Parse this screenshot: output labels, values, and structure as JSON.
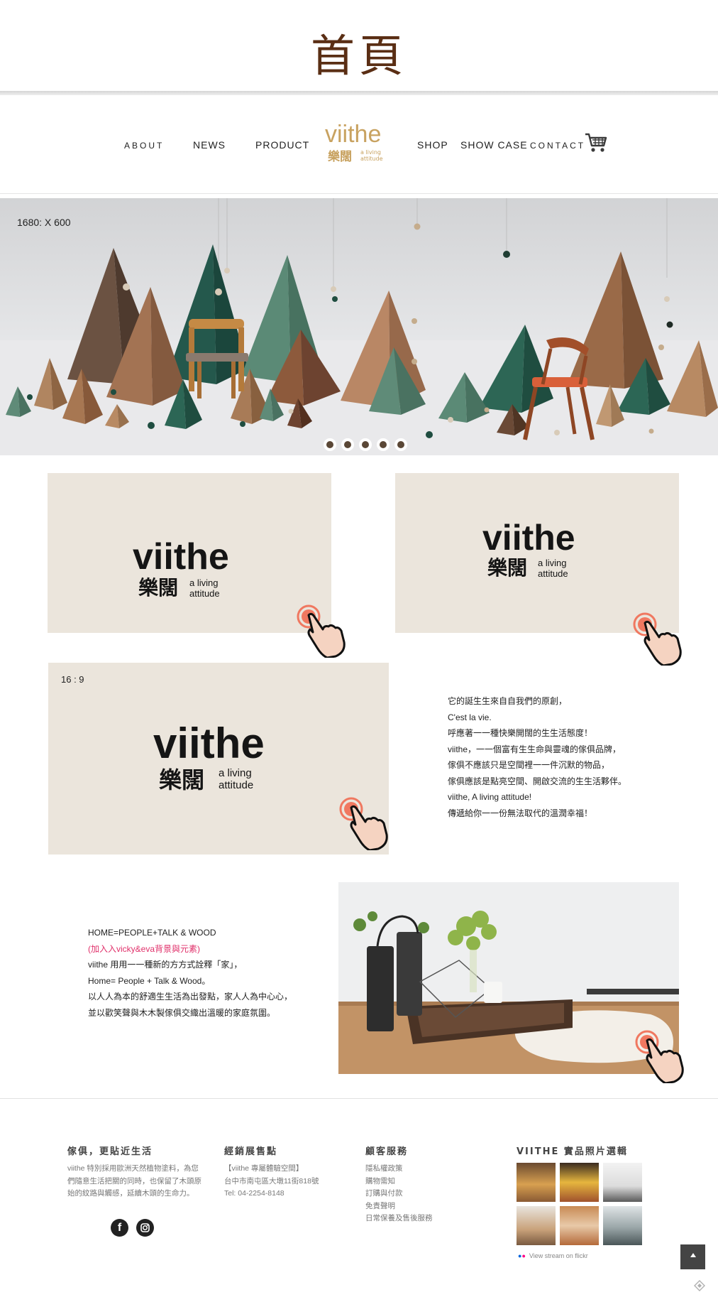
{
  "page_heading": "首頁",
  "nav": {
    "about": "ABOUT",
    "news": "NEWS",
    "product": "PRODUCT",
    "shop": "SHOP",
    "showcase": "SHOW CASE",
    "contact": "CONTACT",
    "logo_word": "viithe",
    "logo_cjk": "樂闊",
    "logo_sub": "a living attitude",
    "cart_icon": "shopping-cart-icon"
  },
  "hero": {
    "dimension_label": "1680: X 600",
    "slide_count": 5
  },
  "cards": {
    "brand_word": "viithe",
    "brand_cjk": "樂闊",
    "brand_sub_line1": "a living",
    "brand_sub_line2": "attitude",
    "wide_dimension_label": "16 : 9",
    "hand_icon": "tap-hand-icon"
  },
  "intro_text": [
    "它的誕生生來自自我們的原創，",
    "C'est la vie.",
    "呼應著一一種快樂開闊的生生活態度！",
    "viithe，一一個富有生生命與靈魂的傢俱品牌，",
    "傢俱不應該只是空間裡一一件沉默的物品，",
    "傢俱應該是點亮空間、開啟交流的生生活夥伴。",
    "viithe, A living attitude!",
    "傳遞給你一一份無法取代的溫潤幸福！"
  ],
  "home_text": {
    "line1": "HOME=PEOPLE+TALK & WOOD",
    "line2_pink": "(加入入vicky&eva背景與元素)",
    "line3": "viithe 用用一一種新的方方式詮釋「家」，",
    "line4": "Home= People + Talk & Wood。",
    "line5": "以人人為本的舒適生生活為出發點，家人人為中心心，",
    "line6": "並以歡笑聲與木木製傢俱交織出溫暖的家庭氛圍。"
  },
  "footer": {
    "col1_title": "傢俱，更貼近生活",
    "col1_lines": [
      "viithe 特別採用歐洲天然植物塗料，為您",
      "們隨意生活把關的同時，也保留了木頭原",
      "始的紋路與觸感，延續木頭的生命力。"
    ],
    "col2_title": "經銷展售點",
    "col2_lines": [
      "【viithe 專屬體驗空間】",
      "台中市南屯區大墩11街818號",
      "Tel: 04-2254-8148"
    ],
    "col3_title": "顧客服務",
    "col3_links": [
      "隱私權政策",
      "購物需知",
      "訂購與付款",
      "免責聲明",
      "日常保養及售後服務"
    ],
    "col4_title": "VIITHE 實品照片選輯",
    "flickr_text": "View stream on flickr",
    "social_facebook": "facebook-icon",
    "social_instagram": "instagram-icon",
    "back_to_top": "back-to-top-icon"
  },
  "colors": {
    "heading_brown": "#5a2e14",
    "logo_gold": "#c8a260",
    "card_beige": "#ebe5dc",
    "pink_note": "#e0306a",
    "pyramid_green": "#2f6b5a"
  }
}
